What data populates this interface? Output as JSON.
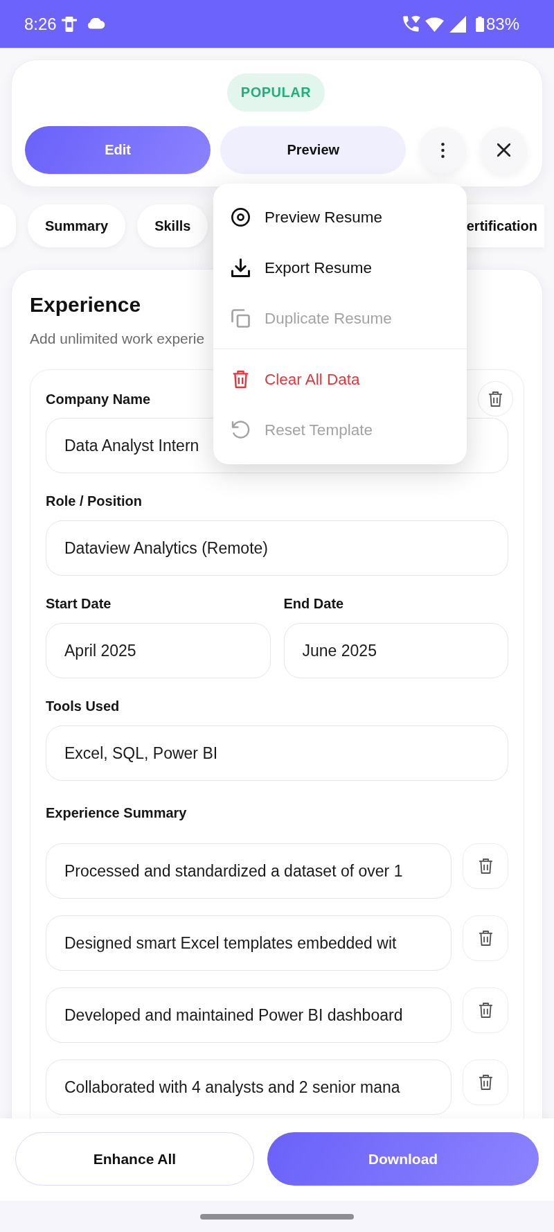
{
  "status_bar": {
    "time": "8:26",
    "battery": "83%"
  },
  "header": {
    "badge": "POPULAR",
    "buttons": [
      {
        "label": "Edit",
        "selected": true
      },
      {
        "label": "Preview",
        "selected": false
      }
    ]
  },
  "tabs": [
    {
      "selected": false
    },
    {
      "label": "Summary",
      "selected": false
    },
    {
      "label": "Skills",
      "selected": false
    },
    {
      "label": "ertification",
      "selected": false
    }
  ],
  "menu": {
    "sections": [
      {
        "items": [
          {
            "label": "Preview Resume",
            "kind": "default",
            "disabled": false
          },
          {
            "label": "Export Resume",
            "kind": "default",
            "disabled": false
          },
          {
            "label": "Duplicate Resume",
            "kind": "default",
            "disabled": true
          }
        ]
      },
      {
        "items": [
          {
            "label": "Clear All Data",
            "kind": "danger",
            "disabled": false
          },
          {
            "label": "Reset Template",
            "kind": "default",
            "disabled": true
          }
        ]
      }
    ]
  },
  "experience": {
    "title": "Experience",
    "subtitle": "Add unlimited work experie",
    "entries": [
      {
        "rows": [
          [
            {
              "label": "Company Name",
              "value": "Data Analyst Intern"
            }
          ],
          [
            {
              "label": "Role / Position",
              "value": "Dataview Analytics (Remote)"
            }
          ],
          [
            {
              "label": "Start Date",
              "value": "April 2025"
            },
            {
              "label": "End Date",
              "value": "June 2025"
            }
          ],
          [
            {
              "label": "Tools Used",
              "value": "Excel, SQL, Power BI"
            }
          ]
        ],
        "summary_label": "Experience Summary",
        "summary_items": [
          "Processed and standardized a dataset of over 1",
          "Designed smart Excel templates embedded wit",
          "Developed and maintained Power BI dashboard",
          "Collaborated with 4 analysts and 2 senior mana"
        ]
      }
    ]
  },
  "footer": {
    "buttons": [
      {
        "label": "Enhance All",
        "kind": "outline"
      },
      {
        "label": "Download",
        "kind": "primary"
      }
    ]
  }
}
